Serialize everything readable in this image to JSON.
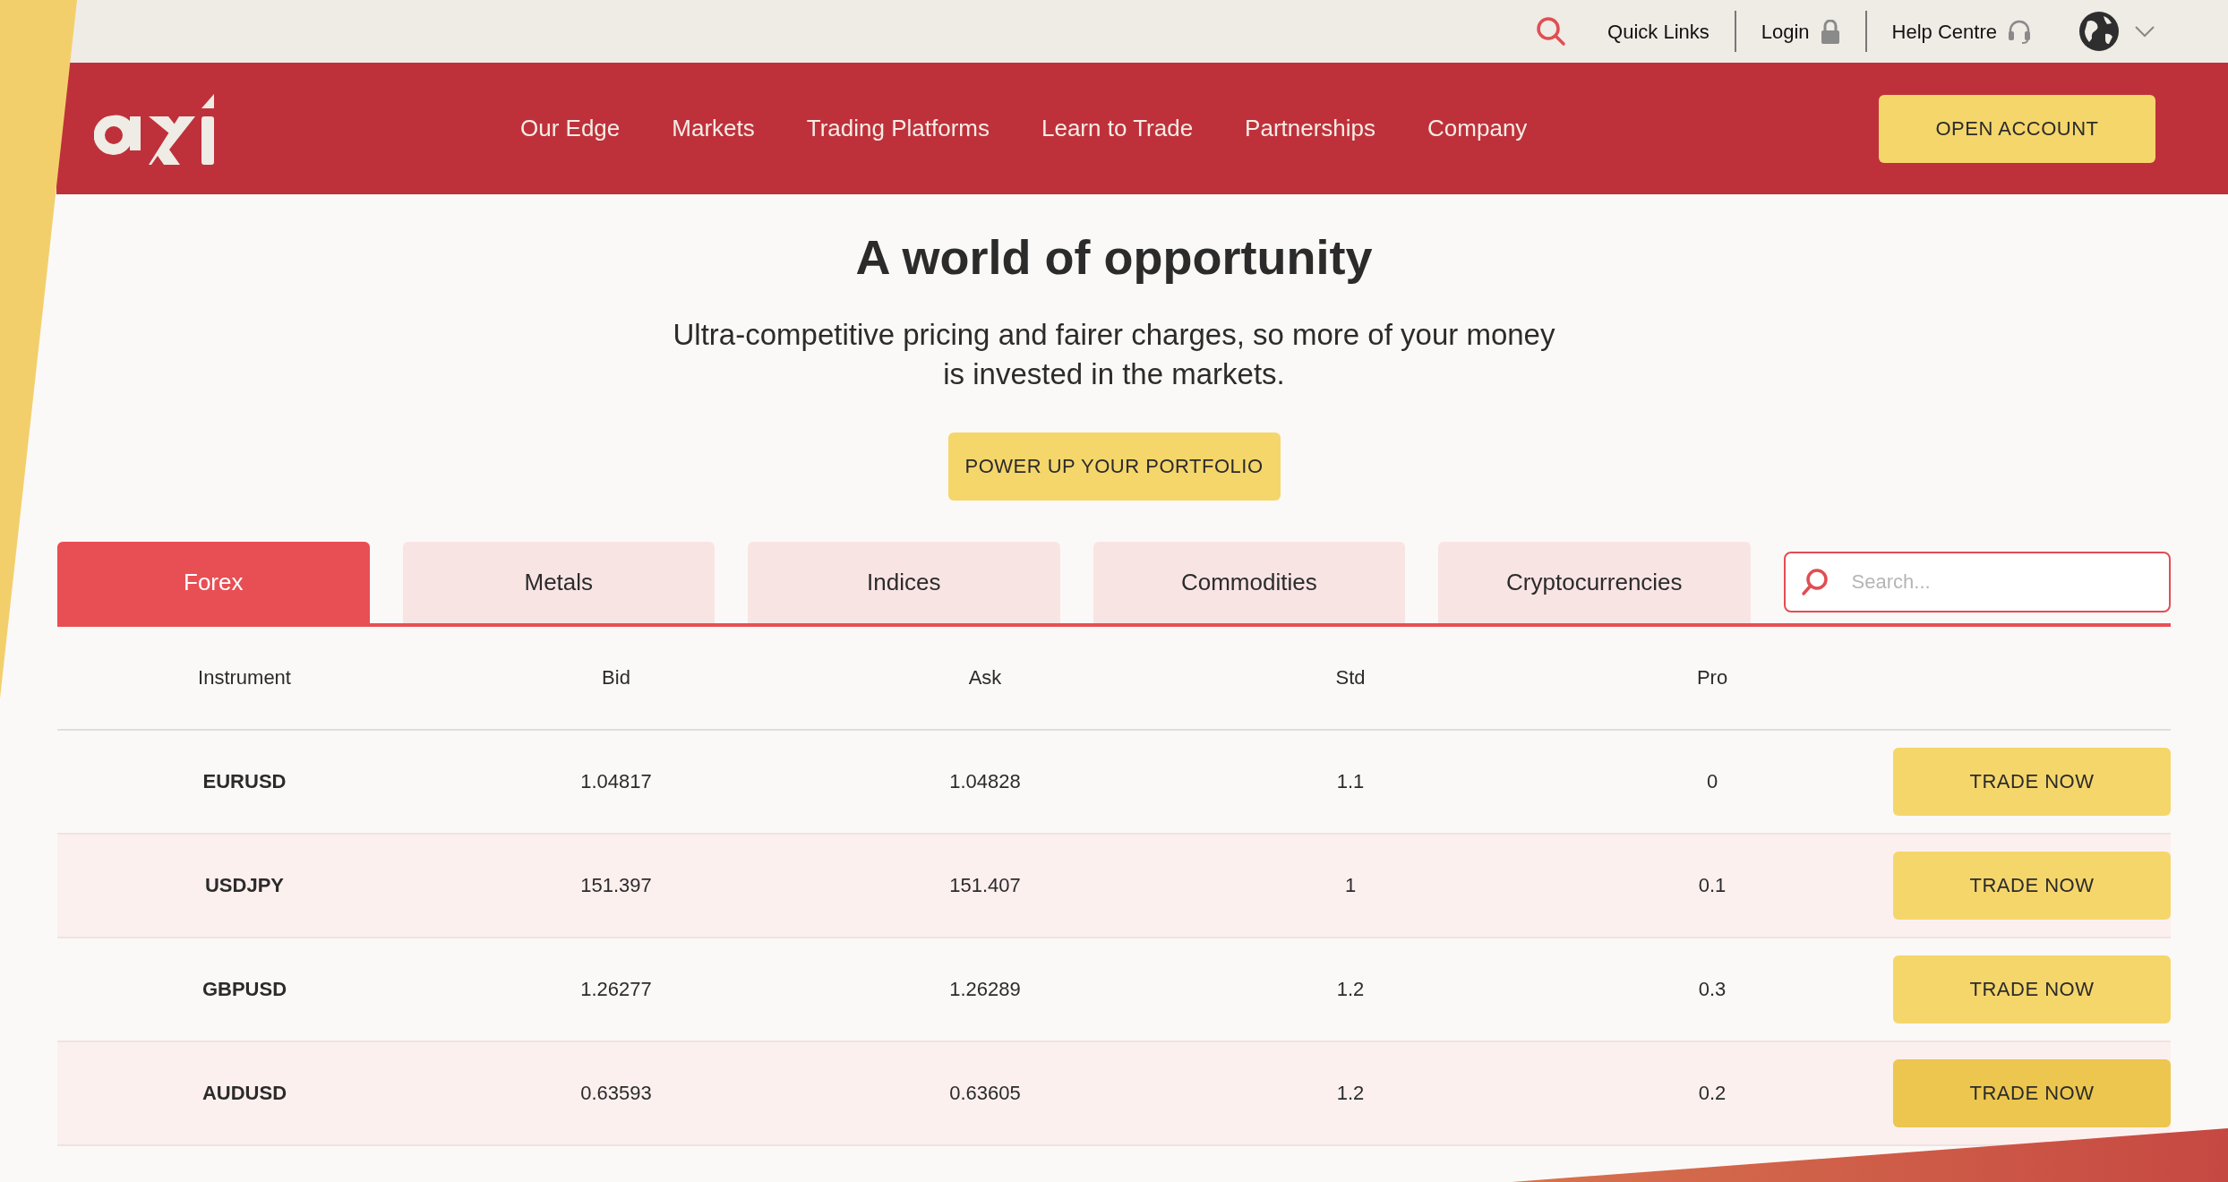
{
  "top_bar": {
    "quick_links": "Quick Links",
    "login": "Login",
    "help": "Help Centre"
  },
  "nav": {
    "links": [
      "Our Edge",
      "Markets",
      "Trading Platforms",
      "Learn to Trade",
      "Partnerships",
      "Company"
    ],
    "cta": "OPEN ACCOUNT"
  },
  "hero": {
    "title": "A world of opportunity",
    "subtitle": "Ultra-competitive pricing and fairer charges, so more of your money is invested in the markets.",
    "button": "POWER UP YOUR PORTFOLIO"
  },
  "tabs": [
    {
      "label": "Forex",
      "selected": true
    },
    {
      "label": "Metals",
      "selected": false
    },
    {
      "label": "Indices",
      "selected": false
    },
    {
      "label": "Commodities",
      "selected": false
    },
    {
      "label": "Cryptocurrencies",
      "selected": false
    }
  ],
  "search": {
    "placeholder": "Search..."
  },
  "table": {
    "columns": [
      "Instrument",
      "Bid",
      "Ask",
      "Std",
      "Pro"
    ],
    "rows": [
      {
        "instrument": "EURUSD",
        "bid": "1.04817",
        "ask": "1.04828",
        "std": "1.1",
        "pro": "0",
        "button": "TRADE NOW",
        "hovered": false
      },
      {
        "instrument": "USDJPY",
        "bid": "151.397",
        "ask": "151.407",
        "std": "1",
        "pro": "0.1",
        "button": "TRADE NOW",
        "hovered": false
      },
      {
        "instrument": "GBPUSD",
        "bid": "1.26277",
        "ask": "1.26289",
        "std": "1.2",
        "pro": "0.3",
        "button": "TRADE NOW",
        "hovered": false
      },
      {
        "instrument": "AUDUSD",
        "bid": "0.63593",
        "ask": "0.63605",
        "std": "1.2",
        "pro": "0.2",
        "button": "TRADE NOW",
        "hovered": true
      }
    ]
  }
}
